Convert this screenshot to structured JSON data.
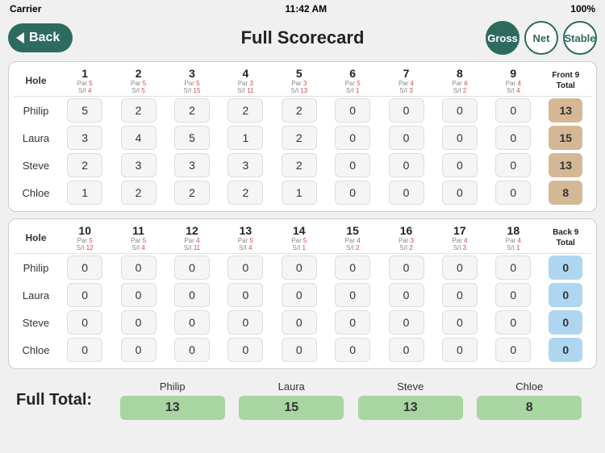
{
  "statusBar": {
    "carrier": "Carrier",
    "wifi": "wifi",
    "time": "11:42 AM",
    "battery": "100%"
  },
  "header": {
    "backLabel": "Back",
    "title": "Full Scorecard",
    "scoreTypes": [
      "Gross",
      "Net",
      "Stable"
    ],
    "activeType": "Gross"
  },
  "frontNine": {
    "sectionTitle": "Front 9",
    "holes": [
      {
        "num": "1",
        "par": "Par 5",
        "si": "S/I 4"
      },
      {
        "num": "2",
        "par": "Par 5",
        "si": "S/I 5"
      },
      {
        "num": "3",
        "par": "Par 5",
        "si": "S/I 15"
      },
      {
        "num": "4",
        "par": "Par 3",
        "si": "S/I 11"
      },
      {
        "num": "5",
        "par": "Par 3",
        "si": "S/I 13"
      },
      {
        "num": "6",
        "par": "Par 5",
        "si": "S/I 1"
      },
      {
        "num": "7",
        "par": "Par 4",
        "si": "S/I 3"
      },
      {
        "num": "8",
        "par": "Par 4",
        "si": "S/I 2"
      },
      {
        "num": "9",
        "par": "Par 4",
        "si": "S/I 4"
      }
    ],
    "totalLabel": "Front 9 Total",
    "players": [
      {
        "name": "Philip",
        "scores": [
          5,
          2,
          2,
          2,
          2,
          0,
          0,
          0,
          0
        ],
        "total": 13
      },
      {
        "name": "Laura",
        "scores": [
          3,
          4,
          5,
          1,
          2,
          0,
          0,
          0,
          0
        ],
        "total": 15
      },
      {
        "name": "Steve",
        "scores": [
          2,
          3,
          3,
          3,
          2,
          0,
          0,
          0,
          0
        ],
        "total": 13
      },
      {
        "name": "Chloe",
        "scores": [
          1,
          2,
          2,
          2,
          1,
          0,
          0,
          0,
          0
        ],
        "total": 8
      }
    ]
  },
  "backNine": {
    "sectionTitle": "Back 9",
    "holes": [
      {
        "num": "10",
        "par": "Par 5",
        "si": "S/I 12"
      },
      {
        "num": "11",
        "par": "Par 5",
        "si": "S/I 4"
      },
      {
        "num": "12",
        "par": "Par 4",
        "si": "S/I 11"
      },
      {
        "num": "13",
        "par": "Par 5",
        "si": "S/I 4"
      },
      {
        "num": "14",
        "par": "Par 5",
        "si": "S/I 1"
      },
      {
        "num": "15",
        "par": "Par 4",
        "si": "S/I 2"
      },
      {
        "num": "16",
        "par": "Par 3",
        "si": "S/I 2"
      },
      {
        "num": "17",
        "par": "Par 4",
        "si": "S/I 3"
      },
      {
        "num": "18",
        "par": "Par 4",
        "si": "S/I 1"
      }
    ],
    "totalLabel": "Back 9 Total",
    "players": [
      {
        "name": "Philip",
        "scores": [
          0,
          0,
          0,
          0,
          0,
          0,
          0,
          0,
          0
        ],
        "total": 0
      },
      {
        "name": "Laura",
        "scores": [
          0,
          0,
          0,
          0,
          0,
          0,
          0,
          0,
          0
        ],
        "total": 0
      },
      {
        "name": "Steve",
        "scores": [
          0,
          0,
          0,
          0,
          0,
          0,
          0,
          0,
          0
        ],
        "total": 0
      },
      {
        "name": "Chloe",
        "scores": [
          0,
          0,
          0,
          0,
          0,
          0,
          0,
          0,
          0
        ],
        "total": 0
      }
    ]
  },
  "fullTotals": {
    "label": "Full Total:",
    "players": [
      {
        "name": "Philip",
        "total": 13
      },
      {
        "name": "Laura",
        "total": 15
      },
      {
        "name": "Steve",
        "total": 13
      },
      {
        "name": "Chloe",
        "total": 8
      }
    ]
  }
}
